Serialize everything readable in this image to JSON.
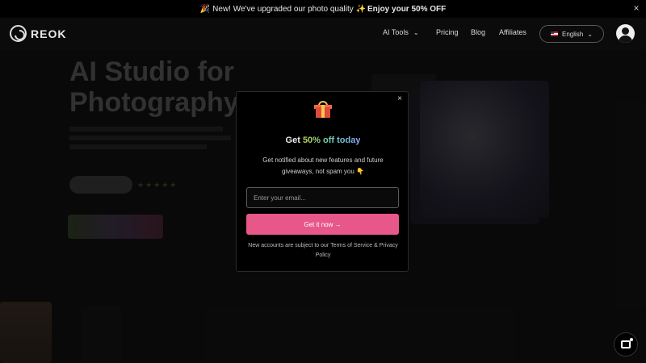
{
  "announcement": {
    "emoji": "🎉",
    "text": "New! We've upgraded our photo quality ✨",
    "highlight": "Enjoy your 50% OFF",
    "close_icon": "×"
  },
  "header": {
    "logo_text": "REOK",
    "nav": {
      "ai_tools": "AI Tools",
      "pricing": "Pricing",
      "blog": "Blog",
      "affiliates": "Affiliates"
    },
    "language": "English"
  },
  "hero": {
    "title": "AI Studio for Photography"
  },
  "modal": {
    "title_prefix": "Get ",
    "title_highlight": "50% off today",
    "description": "Get notified about new features and future giveaways, not spam you 👇",
    "email_placeholder": "Enter your email...",
    "submit_label": "Get it now →",
    "terms": "New accounts are subject to our Terms of Service & Privacy Policy",
    "close_icon": "×"
  },
  "icons": {
    "gift": "gift-icon",
    "chat": "chat-icon",
    "user": "user-icon"
  }
}
